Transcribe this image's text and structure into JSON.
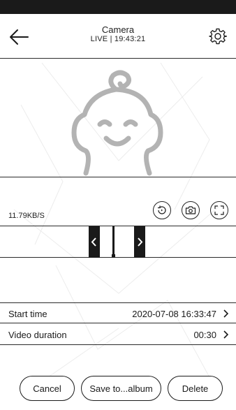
{
  "header": {
    "title": "Camera",
    "live": "LIVE",
    "clock": "19:43:21",
    "back_icon": "arrow-left-icon",
    "settings_icon": "gear-icon"
  },
  "video": {
    "illustration": "baby-face-icon"
  },
  "stream": {
    "speed": "11.79KB/S",
    "icons": [
      "replay-icon",
      "camera-icon",
      "fullscreen-icon"
    ]
  },
  "timeline": {
    "left_handle_icon": "chevron-left-icon",
    "right_handle_icon": "chevron-right-icon"
  },
  "details": {
    "start_time_label": "Start time",
    "start_time_value": "2020-07-08 16:33:47",
    "duration_label": "Video duration",
    "duration_value": "00:30"
  },
  "actions": {
    "cancel": "Cancel",
    "save": "Save to...album",
    "delete": "Delete"
  },
  "colors": {
    "accent": "#1a1a1a",
    "illustration": "#b3b3b3",
    "watermark": "#ececec"
  }
}
